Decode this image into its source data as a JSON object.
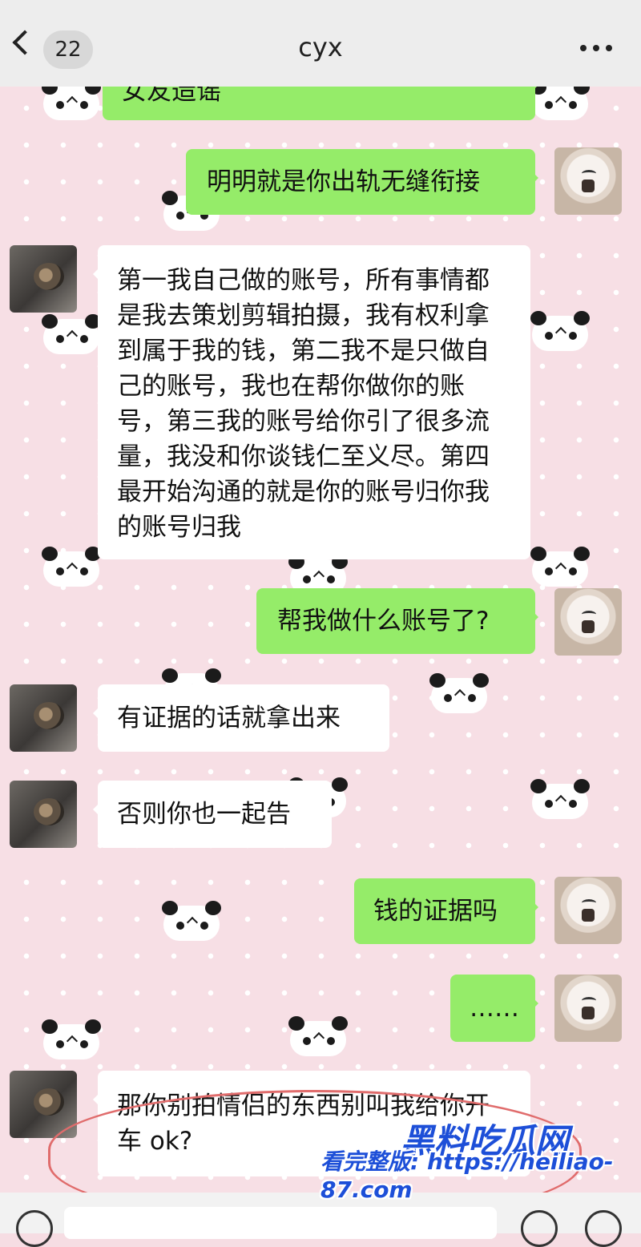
{
  "header": {
    "unread_count": "22",
    "title": "cyx"
  },
  "messages": [
    {
      "sender": "me",
      "text": "女友造谣"
    },
    {
      "sender": "me",
      "text": "明明就是你出轨无缝衔接"
    },
    {
      "sender": "them",
      "text": "第一我自己做的账号，所有事情都是我去策划剪辑拍摄，我有权利拿到属于我的钱，第二我不是只做自己的账号，我也在帮你做你的账号，第三我的账号给你引了很多流量，我没和你谈钱仁至义尽。第四最开始沟通的就是你的账号归你我的账号归我"
    },
    {
      "sender": "me",
      "text": "帮我做什么账号了?"
    },
    {
      "sender": "them",
      "text": "有证据的话就拿出来"
    },
    {
      "sender": "them",
      "text": "否则你也一起告"
    },
    {
      "sender": "me",
      "text": "钱的证据吗"
    },
    {
      "sender": "me",
      "text": "……"
    },
    {
      "sender": "them",
      "text": "那你别拍情侣的东西别叫我给你开车 ok?"
    }
  ],
  "watermark": {
    "brand": "黑料吃瓜网",
    "line2": "看完整版: https://heiliao-87.com"
  },
  "colors": {
    "my_bubble": "#95ec69",
    "their_bubble": "#ffffff",
    "background": "#f7dfe5",
    "annotation_circle": "#e06c6c",
    "watermark": "#1d4fd8"
  }
}
